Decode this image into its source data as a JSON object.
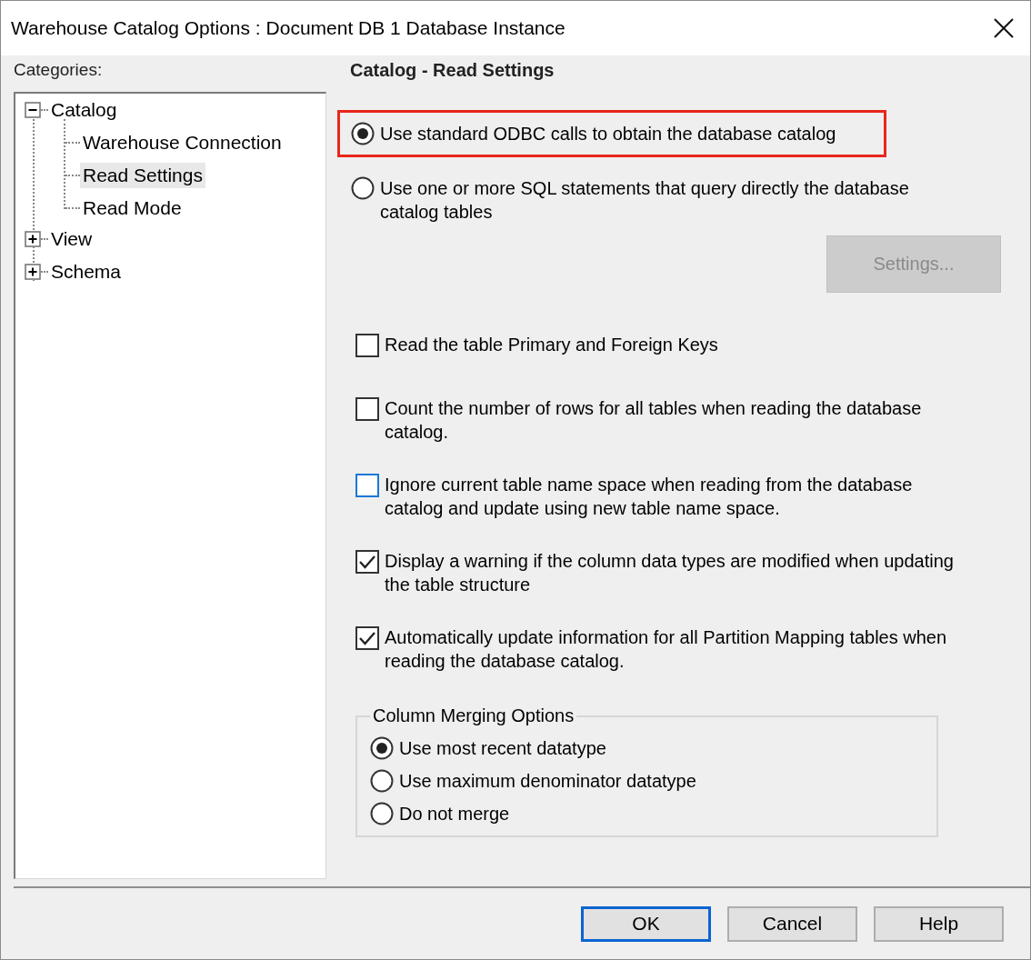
{
  "window": {
    "title": "Warehouse Catalog Options : Document DB 1 Database Instance"
  },
  "categories": {
    "label": "Categories:",
    "items": [
      {
        "label": "Catalog",
        "expanded": true,
        "selected": false,
        "children": [
          {
            "label": "Warehouse Connection",
            "selected": false
          },
          {
            "label": "Read Settings",
            "selected": true
          },
          {
            "label": "Read Mode",
            "selected": false
          }
        ]
      },
      {
        "label": "View",
        "expanded": false,
        "selected": false
      },
      {
        "label": "Schema",
        "expanded": false,
        "selected": false
      }
    ]
  },
  "panel": {
    "heading": "Catalog - Read Settings",
    "source_options": [
      {
        "label": "Use standard ODBC calls to obtain the database catalog",
        "selected": true,
        "highlighted": true
      },
      {
        "label": "Use one or more SQL statements that query directly the database catalog tables",
        "selected": false,
        "highlighted": false
      }
    ],
    "settings_button": {
      "label": "Settings...",
      "disabled": true
    },
    "checkboxes": [
      {
        "label": "Read the table Primary and Foreign Keys",
        "checked": false,
        "focused": false
      },
      {
        "label": "Count the number of rows for all tables when reading the database catalog.",
        "checked": false,
        "focused": false
      },
      {
        "label": "Ignore current table name space when reading from the database catalog and update using new table name space.",
        "checked": false,
        "focused": true
      },
      {
        "label": "Display a warning if the column data types are modified when updating the table structure",
        "checked": true,
        "focused": false
      },
      {
        "label": "Automatically update information for all Partition Mapping tables when reading the database catalog.",
        "checked": true,
        "focused": false
      }
    ],
    "merge_group": {
      "title": "Column Merging Options",
      "options": [
        {
          "label": "Use most recent datatype",
          "selected": true
        },
        {
          "label": "Use maximum denominator datatype",
          "selected": false
        },
        {
          "label": "Do not merge",
          "selected": false
        }
      ]
    }
  },
  "buttons": [
    {
      "label": "OK",
      "default": true
    },
    {
      "label": "Cancel",
      "default": false
    },
    {
      "label": "Help",
      "default": false
    }
  ]
}
